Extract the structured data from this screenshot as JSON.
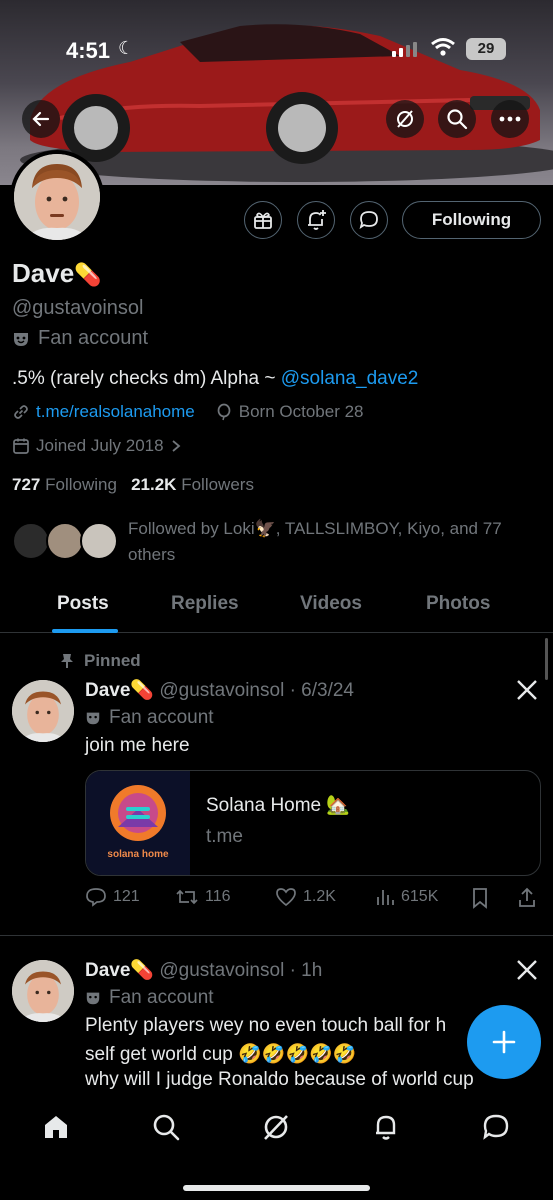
{
  "status_bar": {
    "time": "4:51",
    "battery": "29"
  },
  "profile": {
    "name": "Dave",
    "name_emoji": "💊",
    "handle": "@gustavoinsol",
    "label": "Fan account",
    "bio_text": ".5% (rarely checks dm) Alpha ~ ",
    "bio_mention": "@solana_dave2",
    "link": "t.me/realsolanahome",
    "birthday": "Born October 28",
    "joined": "Joined July 2018",
    "following_count": "727",
    "following_label": "Following",
    "followers_count": "21.2K",
    "followers_label": "Followers",
    "followed_by": "Followed by Loki🦅, TALLSLIMBOY, Kiyo, and 77 others",
    "following_button": "Following"
  },
  "tabs": [
    {
      "label": "Posts",
      "active": true
    },
    {
      "label": "Replies",
      "active": false
    },
    {
      "label": "Videos",
      "active": false
    },
    {
      "label": "Photos",
      "active": false
    }
  ],
  "posts": [
    {
      "pinned_label": "Pinned",
      "name": "Dave",
      "emoji": "💊",
      "handle_date": "@gustavoinsol · 6/3/24",
      "label": "Fan account",
      "text": "join me here",
      "card": {
        "title": "Solana Home 🏡",
        "domain": "t.me",
        "logo_text": "solana home"
      },
      "stats": {
        "replies": "121",
        "reposts": "116",
        "likes": "1.2K",
        "views": "615K"
      }
    },
    {
      "name": "Dave",
      "emoji": "💊",
      "handle_date": "@gustavoinsol · 1h",
      "label": "Fan account",
      "line1": "Plenty players wey no even touch ball for h",
      "line2": "self get world cup 🤣🤣🤣🤣🤣",
      "line3": "why will I judge Ronaldo because of world cup"
    }
  ],
  "colors": {
    "accent": "#1d9bf0",
    "muted": "#71767b",
    "text": "#e7e9ea",
    "border": "#2f3336",
    "background": "#000000"
  }
}
